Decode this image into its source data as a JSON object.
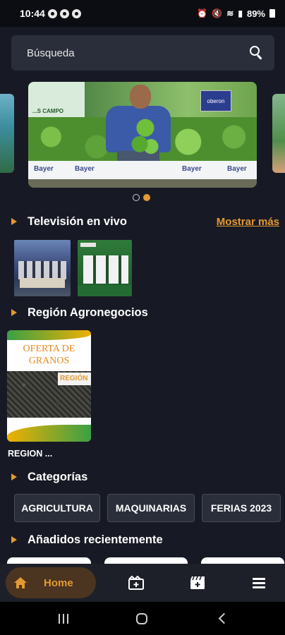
{
  "status_bar": {
    "time": "10:44",
    "battery": "89%"
  },
  "search": {
    "placeholder": "Búsqueda",
    "icon": "search-icon"
  },
  "carousel": {
    "slide_count": 2,
    "active_index": 1,
    "banner_text": "...S CAMPO",
    "sign_text": "oberon",
    "fence_brand": "Bayer"
  },
  "sections": {
    "live_tv": {
      "title": "Televisión en vivo",
      "more_label": "Mostrar más"
    },
    "region": {
      "title": "Región Agronegocios",
      "card_title_line1": "OFERTA DE",
      "card_title_line2": "GRANOS",
      "card_tag": "REGIÓN",
      "card_caption": "REGION ..."
    },
    "categories": {
      "title": "Categorías",
      "items": [
        "AGRICULTURA",
        "MAQUINARIAS",
        "FERIAS 2023"
      ]
    },
    "recent": {
      "title": "Añadidos recientemente"
    }
  },
  "bottom_nav": {
    "home_label": "Home",
    "accent_color": "#e39a33"
  }
}
